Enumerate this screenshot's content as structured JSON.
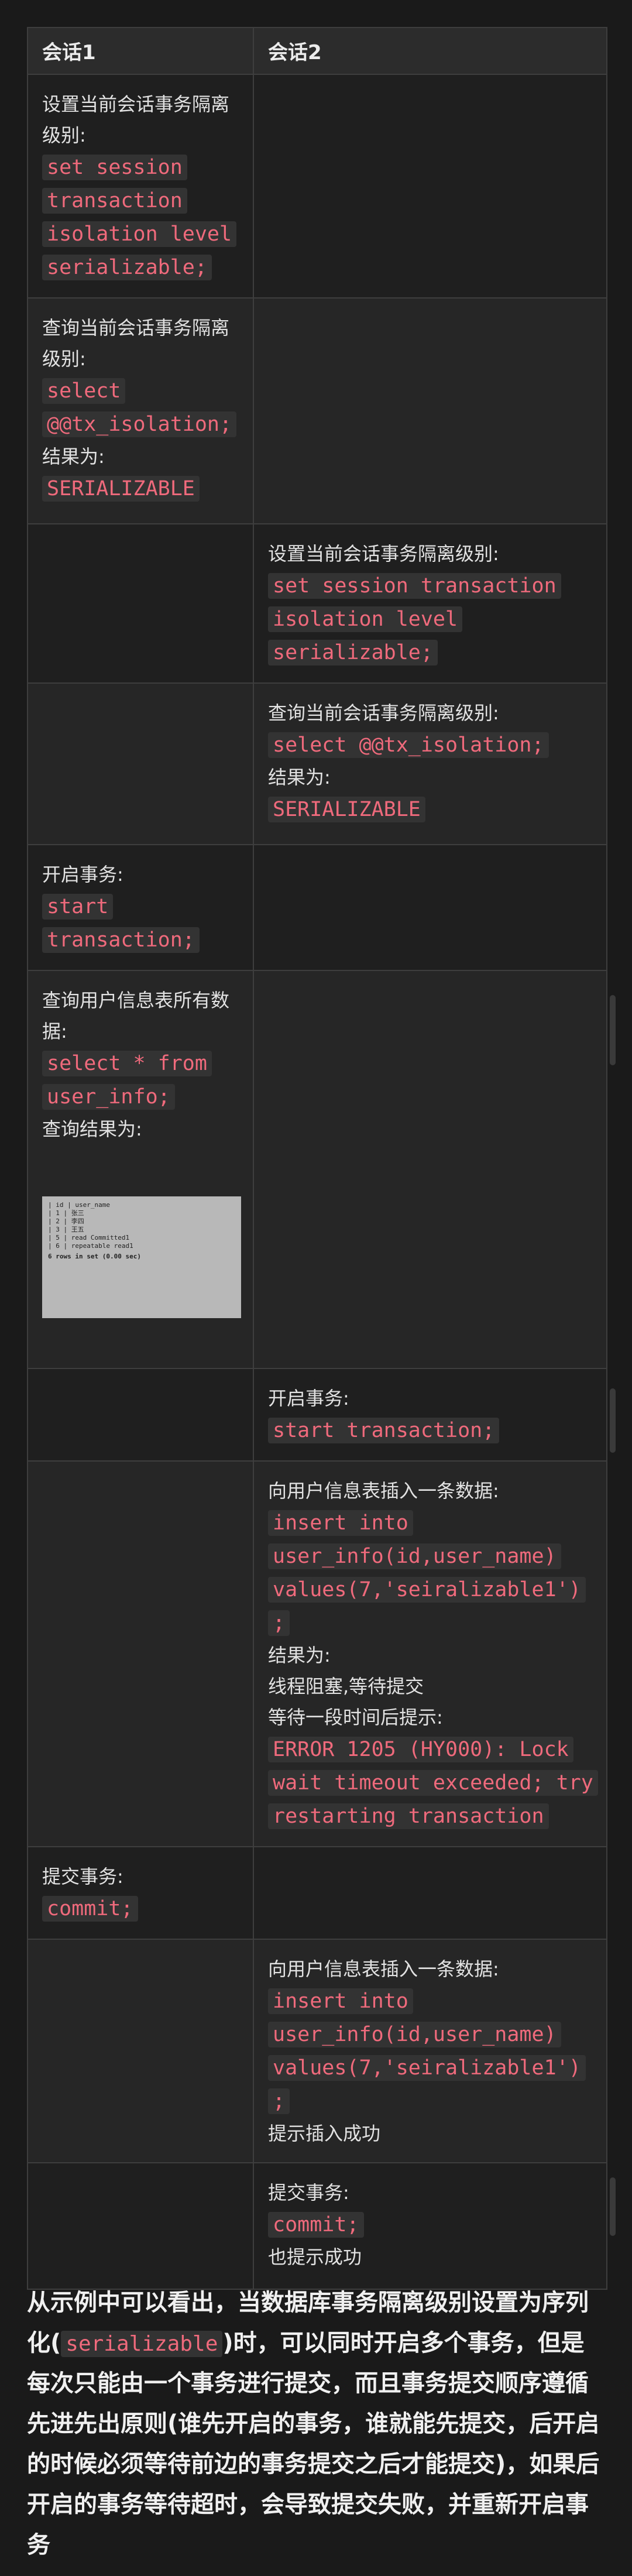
{
  "table": {
    "headers": [
      "会话1",
      "会话2"
    ],
    "rows": [
      {
        "s1": {
          "l1": "设置当前会话事务隔离级别:",
          "c1": "set session transaction isolation level serializable;"
        },
        "s2": null
      },
      {
        "s1": {
          "l1": "查询当前会话事务隔离级别:",
          "c1": "select @@tx_isolation;",
          "l2": "结果为:",
          "c2": "SERIALIZABLE"
        },
        "s2": null
      },
      {
        "s1": null,
        "s2": {
          "l1": "设置当前会话事务隔离级别:",
          "c1": "set session transaction isolation level serializable;"
        }
      },
      {
        "s1": null,
        "s2": {
          "l1": "查询当前会话事务隔离级别:",
          "c1": "select @@tx_isolation;",
          "l2": "结果为:",
          "c2": "SERIALIZABLE"
        }
      },
      {
        "s1": {
          "l1": "开启事务:",
          "c1": "start transaction;"
        },
        "s2": null
      },
      {
        "s1": {
          "l1": "查询用户信息表所有数据:",
          "c1": "select * from user_info;",
          "l2": "查询结果为:"
        },
        "s2": null
      },
      {
        "s1": null,
        "s2": {
          "l1": "开启事务:",
          "c1": "start transaction;"
        }
      },
      {
        "s1": null,
        "s2": {
          "l1": "向用户信息表插入一条数据:",
          "c1": "insert into user_info(id,user_name) values(7,'seiralizable1');",
          "l2": "结果为:",
          "l3": "线程阻塞,等待提交",
          "l4": "等待一段时间后提示:",
          "c2": "ERROR 1205 (HY000): Lock wait timeout exceeded; try restarting transaction"
        }
      },
      {
        "s1": {
          "l1": "提交事务:",
          "c1": "commit;"
        },
        "s2": null
      },
      {
        "s1": null,
        "s2": {
          "l1": "向用户信息表插入一条数据:",
          "c1": "insert into user_info(id,user_name) values(7,'seiralizable1');",
          "l2": "提示插入成功"
        }
      },
      {
        "s1": null,
        "s2": {
          "l1": "提交事务:",
          "c1": "commit;",
          "l2": "也提示成功"
        }
      }
    ]
  },
  "result_image": {
    "header": [
      "id",
      "user_name"
    ],
    "rows": [
      [
        "1",
        "张三"
      ],
      [
        "2",
        "李四"
      ],
      [
        "3",
        "王五"
      ],
      [
        "5",
        "read Committed1"
      ],
      [
        "6",
        "repeatable read1"
      ]
    ],
    "footer": "6 rows in set (0.00 sec)"
  },
  "summary": {
    "before": "从示例中可以看出，当数据库事务隔离级别设置为序列化(",
    "code": "serializable",
    "after": ")时，可以同时开启多个事务，但是每次只能由一个事务进行提交，而且事务提交顺序遵循先进先出原则(谁先开启的事务，谁就能先提交，后开启的时候必须等待前边的事务提交之后才能提交)，如果后开启的事务等待超时，会导致提交失败，并重新开启事务"
  }
}
